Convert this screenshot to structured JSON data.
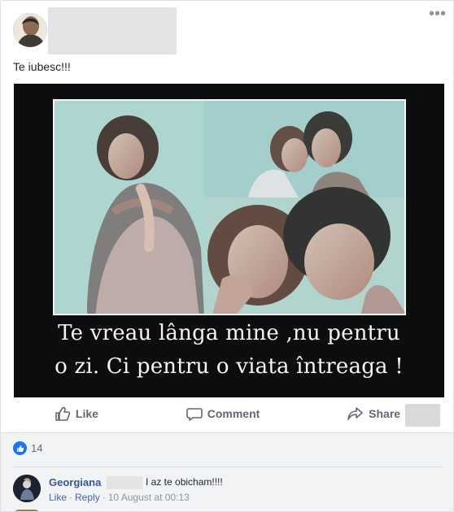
{
  "post": {
    "text": "Te iubesc!!!",
    "more_icon": "more-horizontal-icon"
  },
  "media": {
    "caption_line1": "Te vreau lânga mine ,nu pentru",
    "caption_line2": "o zi. Ci pentru o viata întreaga !"
  },
  "actions": {
    "like_label": "Like",
    "comment_label": "Comment",
    "share_label": "Share"
  },
  "reactions": {
    "count": "14"
  },
  "comment": {
    "author": "Georgiana",
    "text": "I az te obicham!!!!",
    "like_label": "Like",
    "separator": "·",
    "reply_label": "Reply",
    "timestamp": "10 August at 00:13"
  }
}
